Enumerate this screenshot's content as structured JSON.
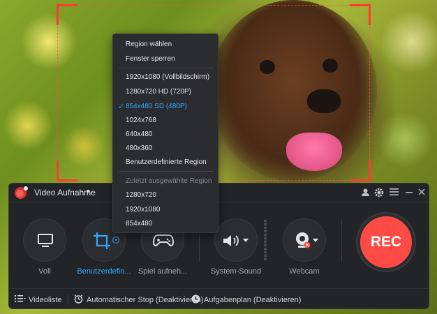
{
  "toolbar": {
    "mode_title": "Video Aufnahme",
    "mode_caret": "▾",
    "tools": [
      {
        "label": "Voll"
      },
      {
        "label": "Benutzerdefin..."
      },
      {
        "label": "Spiel aufneh..."
      },
      {
        "label": "System-Sound"
      },
      {
        "label": "Webcam"
      }
    ],
    "rec_label": "REC"
  },
  "bottom": {
    "video_list": "Videoliste",
    "auto_stop": "Automatischer Stop (Deaktivieren)",
    "task_plan": "Aufgabenplan (Deaktivieren)"
  },
  "menu": {
    "items": [
      {
        "label": "Region wählen"
      },
      {
        "label": "Fenster sperren"
      },
      {
        "label": "1920x1080 (Vollbildschirm)"
      },
      {
        "label": "1280x720 HD (720P)"
      },
      {
        "label": "854x480 SD (480P)"
      },
      {
        "label": "1024x768"
      },
      {
        "label": "640x480"
      },
      {
        "label": "480x360"
      },
      {
        "label": "Benutzerdefinierte Region"
      },
      {
        "label": "Zuletzt ausgewählte Region"
      },
      {
        "label": "1280x720"
      },
      {
        "label": "1920x1080"
      },
      {
        "label": "854x480"
      }
    ],
    "check": "✓"
  },
  "colors": {
    "accent": "#2ea9ff",
    "rec": "#ff4b45",
    "frame": "#ff3b30"
  },
  "icons": [
    "monitor-icon",
    "crop-icon",
    "gamepad-icon",
    "speaker-icon",
    "webcam-icon",
    "user-icon",
    "gear-icon",
    "menu-icon",
    "minimize-icon",
    "close-icon",
    "list-icon",
    "alarm-clock-icon",
    "clock-icon"
  ]
}
